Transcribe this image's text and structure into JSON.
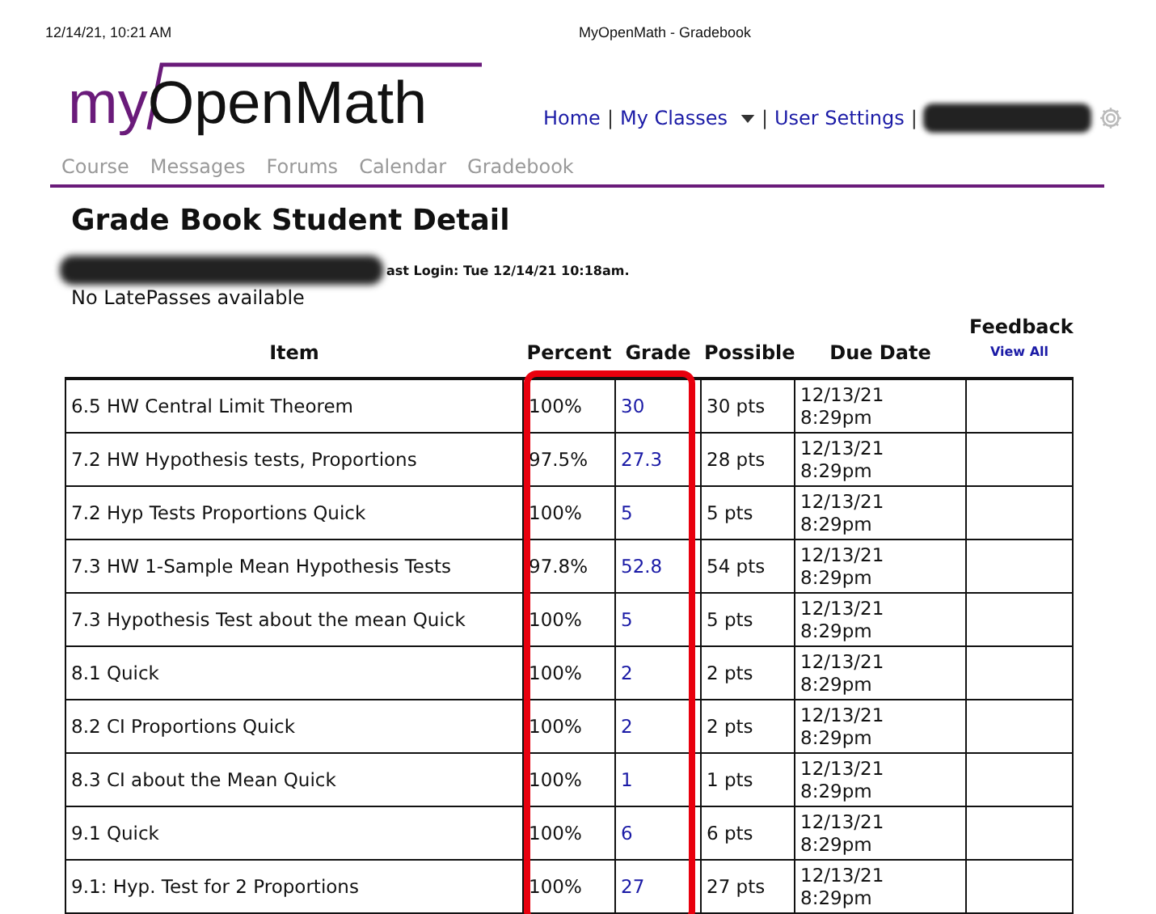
{
  "print_header": {
    "timestamp": "12/14/21, 10:21 AM",
    "title": "MyOpenMath - Gradebook"
  },
  "logo": {
    "prefix": "my",
    "name": "OpenMath"
  },
  "top_nav": [
    {
      "label": "Home",
      "dropdown": false
    },
    {
      "label": "My Classes",
      "dropdown": true
    },
    {
      "label": "User Settings",
      "dropdown": false
    }
  ],
  "nav_separator": "|",
  "tabs": [
    "Course",
    "Messages",
    "Forums",
    "Calendar",
    "Gradebook"
  ],
  "page_title": "Grade Book Student Detail",
  "last_login": "ast Login: Tue 12/14/21 10:18am.",
  "latepasses": "No LatePasses available",
  "table": {
    "columns": [
      "Item",
      "Percent",
      "Grade",
      "Possible",
      "Due Date",
      "Feedback"
    ],
    "feedback_link": "View All",
    "rows": [
      {
        "item": "6.5 HW Central Limit Theorem",
        "percent": "100%",
        "grade": "30",
        "possible": "30 pts",
        "due_date": "12/13/21",
        "due_time": "8:29pm"
      },
      {
        "item": "7.2 HW Hypothesis tests, Proportions",
        "percent": "97.5%",
        "grade": "27.3",
        "possible": "28 pts",
        "due_date": "12/13/21",
        "due_time": "8:29pm"
      },
      {
        "item": "7.2 Hyp Tests Proportions Quick",
        "percent": "100%",
        "grade": "5",
        "possible": "5 pts",
        "due_date": "12/13/21",
        "due_time": "8:29pm"
      },
      {
        "item": "7.3 HW 1-Sample Mean Hypothesis Tests",
        "percent": "97.8%",
        "grade": "52.8",
        "possible": "54 pts",
        "due_date": "12/13/21",
        "due_time": "8:29pm"
      },
      {
        "item": "7.3 Hypothesis Test about the mean Quick",
        "percent": "100%",
        "grade": "5",
        "possible": "5 pts",
        "due_date": "12/13/21",
        "due_time": "8:29pm"
      },
      {
        "item": "8.1 Quick",
        "percent": "100%",
        "grade": "2",
        "possible": "2 pts",
        "due_date": "12/13/21",
        "due_time": "8:29pm"
      },
      {
        "item": "8.2 CI Proportions Quick",
        "percent": "100%",
        "grade": "2",
        "possible": "2 pts",
        "due_date": "12/13/21",
        "due_time": "8:29pm"
      },
      {
        "item": "8.3 CI about the Mean Quick",
        "percent": "100%",
        "grade": "1",
        "possible": "1 pts",
        "due_date": "12/13/21",
        "due_time": "8:29pm"
      },
      {
        "item": "9.1 Quick",
        "percent": "100%",
        "grade": "6",
        "possible": "6 pts",
        "due_date": "12/13/21",
        "due_time": "8:29pm"
      },
      {
        "item": "9.1: Hyp. Test for 2 Proportions",
        "percent": "100%",
        "grade": "27",
        "possible": "27 pts",
        "due_date": "12/13/21",
        "due_time": "8:29pm"
      }
    ]
  }
}
